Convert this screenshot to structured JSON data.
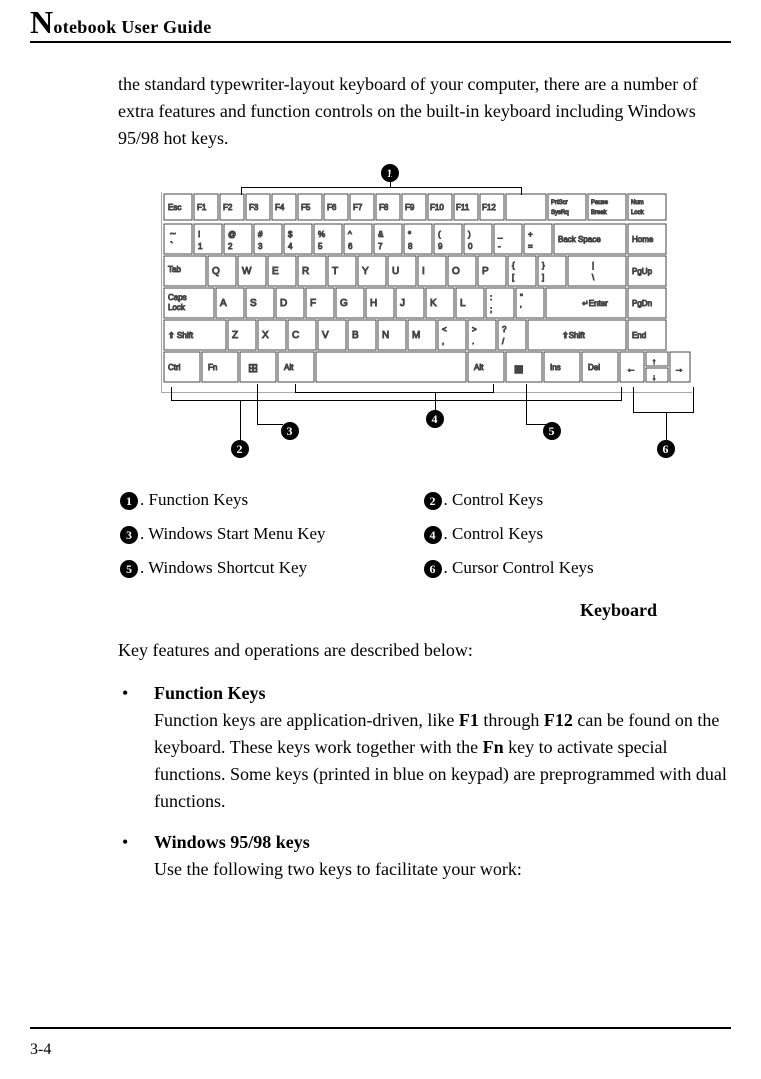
{
  "header": {
    "title_prefix_cap": "N",
    "title_rest": "otebook User Guide"
  },
  "intro": "the standard typewriter-layout keyboard of your computer, there are a number of extra features and function controls on the built-in keyboard including Windows 95/98 hot keys.",
  "diagram": {
    "labels": [
      "1",
      "2",
      "3",
      "4",
      "5",
      "6"
    ]
  },
  "legend": {
    "rows": [
      {
        "left_num": "1",
        "left_text": ". Function Keys",
        "right_num": "2",
        "right_text": ". Control Keys"
      },
      {
        "left_num": "3",
        "left_text": ". Windows Start Menu Key",
        "right_num": "4",
        "right_text": ". Control Keys"
      },
      {
        "left_num": "5",
        "left_text": ". Windows Shortcut Key",
        "right_num": "6",
        "right_text": ". Cursor Control Keys"
      }
    ]
  },
  "subheading": "Keyboard",
  "body_sentence": "Key features and operations are described below:",
  "items": [
    {
      "title": "Function Keys",
      "text_parts": [
        "Function keys are application-driven, like ",
        "F1",
        " through ",
        "F12",
        " can be found on the keyboard. These keys work together with the ",
        "Fn",
        " key to activate special functions. Some keys (printed in blue on keypad) are preprogrammed with dual functions."
      ]
    },
    {
      "title": "Windows 95/98 keys",
      "text_parts": [
        "Use the following two keys to facilitate your work:"
      ]
    }
  ],
  "footer": {
    "page_number": "3-4"
  }
}
